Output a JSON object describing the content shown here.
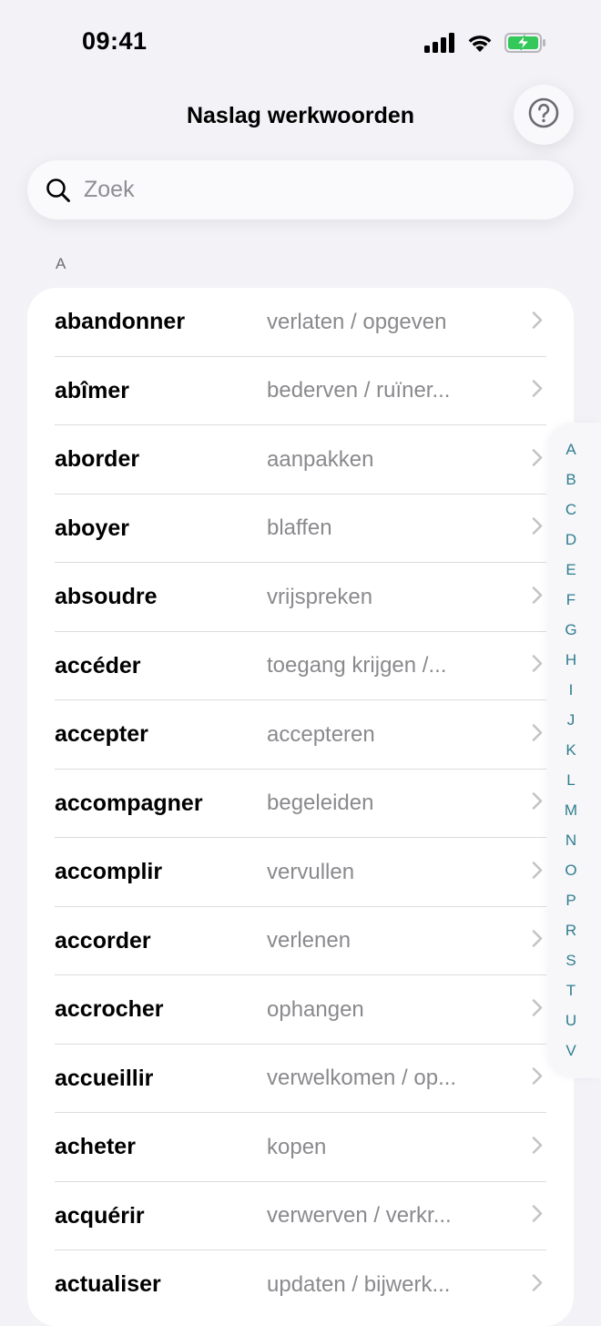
{
  "status_bar": {
    "time": "09:41"
  },
  "header": {
    "title": "Naslag werkwoorden",
    "help_icon": "question-mark-circle-icon"
  },
  "search": {
    "placeholder": "Zoek",
    "value": "",
    "icon": "magnifying-glass-icon"
  },
  "section": {
    "label": "A"
  },
  "verbs": [
    {
      "verb": "abandonner",
      "translation": "verlaten / opgeven"
    },
    {
      "verb": "abîmer",
      "translation": "bederven / ruïner..."
    },
    {
      "verb": "aborder",
      "translation": "aanpakken"
    },
    {
      "verb": "aboyer",
      "translation": "blaffen"
    },
    {
      "verb": "absoudre",
      "translation": "vrijspreken"
    },
    {
      "verb": "accéder",
      "translation": "toegang krijgen /..."
    },
    {
      "verb": "accepter",
      "translation": "accepteren"
    },
    {
      "verb": "accompagner",
      "translation": "begeleiden"
    },
    {
      "verb": "accomplir",
      "translation": "vervullen"
    },
    {
      "verb": "accorder",
      "translation": "verlenen"
    },
    {
      "verb": "accrocher",
      "translation": "ophangen"
    },
    {
      "verb": "accueillir",
      "translation": "verwelkomen / op..."
    },
    {
      "verb": "acheter",
      "translation": "kopen"
    },
    {
      "verb": "acquérir",
      "translation": "verwerven / verkr..."
    },
    {
      "verb": "actualiser",
      "translation": "updaten / bijwerk..."
    }
  ],
  "index_letters": [
    "A",
    "B",
    "C",
    "D",
    "E",
    "F",
    "G",
    "H",
    "I",
    "J",
    "K",
    "L",
    "M",
    "N",
    "O",
    "P",
    "R",
    "S",
    "T",
    "U",
    "V"
  ],
  "colors": {
    "background": "#f2f2f7",
    "accent": "#2f7d8d",
    "battery": "#34c759"
  }
}
